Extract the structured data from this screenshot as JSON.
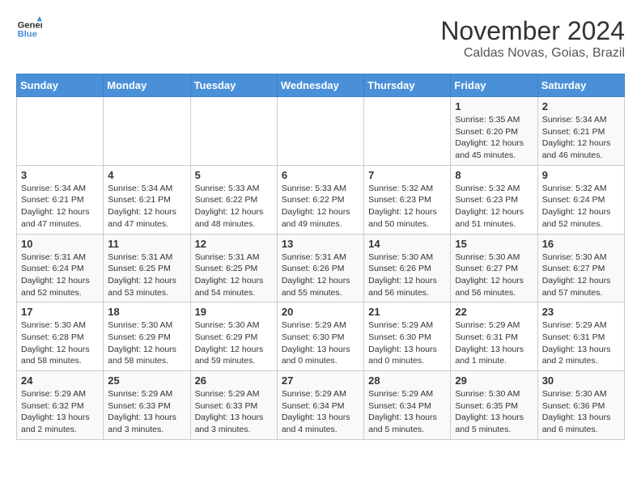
{
  "logo": {
    "line1": "General",
    "line2": "Blue"
  },
  "title": "November 2024",
  "location": "Caldas Novas, Goias, Brazil",
  "weekdays": [
    "Sunday",
    "Monday",
    "Tuesday",
    "Wednesday",
    "Thursday",
    "Friday",
    "Saturday"
  ],
  "weeks": [
    [
      {
        "day": "",
        "info": ""
      },
      {
        "day": "",
        "info": ""
      },
      {
        "day": "",
        "info": ""
      },
      {
        "day": "",
        "info": ""
      },
      {
        "day": "",
        "info": ""
      },
      {
        "day": "1",
        "info": "Sunrise: 5:35 AM\nSunset: 6:20 PM\nDaylight: 12 hours and 45 minutes."
      },
      {
        "day": "2",
        "info": "Sunrise: 5:34 AM\nSunset: 6:21 PM\nDaylight: 12 hours and 46 minutes."
      }
    ],
    [
      {
        "day": "3",
        "info": "Sunrise: 5:34 AM\nSunset: 6:21 PM\nDaylight: 12 hours and 47 minutes."
      },
      {
        "day": "4",
        "info": "Sunrise: 5:34 AM\nSunset: 6:21 PM\nDaylight: 12 hours and 47 minutes."
      },
      {
        "day": "5",
        "info": "Sunrise: 5:33 AM\nSunset: 6:22 PM\nDaylight: 12 hours and 48 minutes."
      },
      {
        "day": "6",
        "info": "Sunrise: 5:33 AM\nSunset: 6:22 PM\nDaylight: 12 hours and 49 minutes."
      },
      {
        "day": "7",
        "info": "Sunrise: 5:32 AM\nSunset: 6:23 PM\nDaylight: 12 hours and 50 minutes."
      },
      {
        "day": "8",
        "info": "Sunrise: 5:32 AM\nSunset: 6:23 PM\nDaylight: 12 hours and 51 minutes."
      },
      {
        "day": "9",
        "info": "Sunrise: 5:32 AM\nSunset: 6:24 PM\nDaylight: 12 hours and 52 minutes."
      }
    ],
    [
      {
        "day": "10",
        "info": "Sunrise: 5:31 AM\nSunset: 6:24 PM\nDaylight: 12 hours and 52 minutes."
      },
      {
        "day": "11",
        "info": "Sunrise: 5:31 AM\nSunset: 6:25 PM\nDaylight: 12 hours and 53 minutes."
      },
      {
        "day": "12",
        "info": "Sunrise: 5:31 AM\nSunset: 6:25 PM\nDaylight: 12 hours and 54 minutes."
      },
      {
        "day": "13",
        "info": "Sunrise: 5:31 AM\nSunset: 6:26 PM\nDaylight: 12 hours and 55 minutes."
      },
      {
        "day": "14",
        "info": "Sunrise: 5:30 AM\nSunset: 6:26 PM\nDaylight: 12 hours and 56 minutes."
      },
      {
        "day": "15",
        "info": "Sunrise: 5:30 AM\nSunset: 6:27 PM\nDaylight: 12 hours and 56 minutes."
      },
      {
        "day": "16",
        "info": "Sunrise: 5:30 AM\nSunset: 6:27 PM\nDaylight: 12 hours and 57 minutes."
      }
    ],
    [
      {
        "day": "17",
        "info": "Sunrise: 5:30 AM\nSunset: 6:28 PM\nDaylight: 12 hours and 58 minutes."
      },
      {
        "day": "18",
        "info": "Sunrise: 5:30 AM\nSunset: 6:29 PM\nDaylight: 12 hours and 58 minutes."
      },
      {
        "day": "19",
        "info": "Sunrise: 5:30 AM\nSunset: 6:29 PM\nDaylight: 12 hours and 59 minutes."
      },
      {
        "day": "20",
        "info": "Sunrise: 5:29 AM\nSunset: 6:30 PM\nDaylight: 13 hours and 0 minutes."
      },
      {
        "day": "21",
        "info": "Sunrise: 5:29 AM\nSunset: 6:30 PM\nDaylight: 13 hours and 0 minutes."
      },
      {
        "day": "22",
        "info": "Sunrise: 5:29 AM\nSunset: 6:31 PM\nDaylight: 13 hours and 1 minute."
      },
      {
        "day": "23",
        "info": "Sunrise: 5:29 AM\nSunset: 6:31 PM\nDaylight: 13 hours and 2 minutes."
      }
    ],
    [
      {
        "day": "24",
        "info": "Sunrise: 5:29 AM\nSunset: 6:32 PM\nDaylight: 13 hours and 2 minutes."
      },
      {
        "day": "25",
        "info": "Sunrise: 5:29 AM\nSunset: 6:33 PM\nDaylight: 13 hours and 3 minutes."
      },
      {
        "day": "26",
        "info": "Sunrise: 5:29 AM\nSunset: 6:33 PM\nDaylight: 13 hours and 3 minutes."
      },
      {
        "day": "27",
        "info": "Sunrise: 5:29 AM\nSunset: 6:34 PM\nDaylight: 13 hours and 4 minutes."
      },
      {
        "day": "28",
        "info": "Sunrise: 5:29 AM\nSunset: 6:34 PM\nDaylight: 13 hours and 5 minutes."
      },
      {
        "day": "29",
        "info": "Sunrise: 5:30 AM\nSunset: 6:35 PM\nDaylight: 13 hours and 5 minutes."
      },
      {
        "day": "30",
        "info": "Sunrise: 5:30 AM\nSunset: 6:36 PM\nDaylight: 13 hours and 6 minutes."
      }
    ]
  ]
}
